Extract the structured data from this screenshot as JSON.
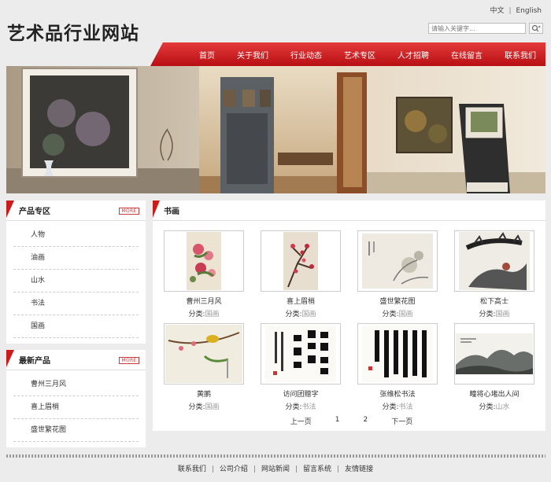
{
  "lang": {
    "zh": "中文",
    "sep": "|",
    "en": "English"
  },
  "logo": "艺术品行业网站",
  "search": {
    "placeholder": "请输入关键字..."
  },
  "nav": [
    "首页",
    "关于我们",
    "行业动态",
    "艺术专区",
    "人才招聘",
    "在线留言",
    "联系我们"
  ],
  "side": {
    "products": {
      "title": "产品专区",
      "more": "MORE",
      "items": [
        "人物",
        "油画",
        "山水",
        "书法",
        "国画"
      ]
    },
    "latest": {
      "title": "最新产品",
      "more": "MORE",
      "items": [
        "曹州三月风",
        "喜上眉梢",
        "盛世繁花图"
      ]
    }
  },
  "main": {
    "title": "书画",
    "cat_label": "分类:",
    "items": [
      {
        "name": "曹州三月风",
        "cat": "国画"
      },
      {
        "name": "喜上眉梢",
        "cat": "国画"
      },
      {
        "name": "盛世繁花图",
        "cat": "国画"
      },
      {
        "name": "松下高士",
        "cat": "国画"
      },
      {
        "name": "黄鹂",
        "cat": "国画"
      },
      {
        "name": "访问团赠字",
        "cat": "书法"
      },
      {
        "name": "张维松书法",
        "cat": "书法"
      },
      {
        "name": "疃将心堵出人间",
        "cat": "山水"
      }
    ],
    "pager": {
      "prev": "上一页",
      "p1": "1",
      "p2": "2",
      "next": "下一页"
    }
  },
  "footer": [
    "联系我们",
    "公司介绍",
    "网站新闻",
    "留言系统",
    "友情链接"
  ],
  "colors": {
    "accent": "#cc1b1b",
    "nav_top": "#e43a3a",
    "nav_bottom": "#b80f14"
  }
}
